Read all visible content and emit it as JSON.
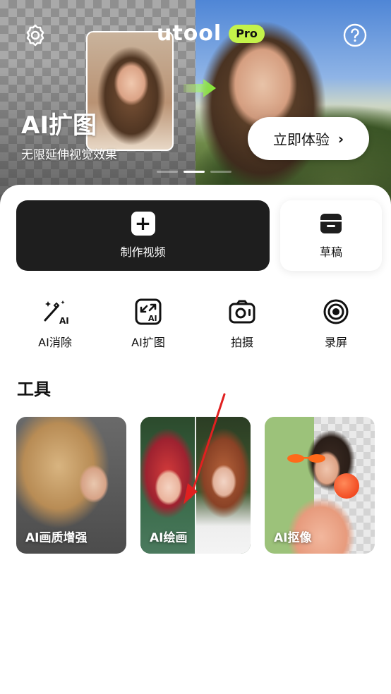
{
  "header": {
    "app_name": "utool",
    "pro_badge": "Pro"
  },
  "banner": {
    "title": "AI扩图",
    "subtitle": "无限延伸视觉效果",
    "cta_label": "立即体验",
    "page_count": 3,
    "active_page": 2
  },
  "actions": {
    "make_video": "制作视频",
    "drafts": "草稿"
  },
  "quick_tools": [
    {
      "label": "AI消除",
      "icon": "magic-wand-ai-icon"
    },
    {
      "label": "AI扩图",
      "icon": "expand-ai-icon"
    },
    {
      "label": "拍摄",
      "icon": "camera-icon"
    },
    {
      "label": "录屏",
      "icon": "screen-record-icon"
    }
  ],
  "tools_section": {
    "title": "工具",
    "cards": [
      {
        "label": "AI画质增强"
      },
      {
        "label": "AI绘画"
      },
      {
        "label": "AI抠像"
      }
    ]
  },
  "colors": {
    "pro_badge": "#c4f24a",
    "dark_button": "#1e1e1e",
    "annotation_arrow": "#e02020"
  }
}
